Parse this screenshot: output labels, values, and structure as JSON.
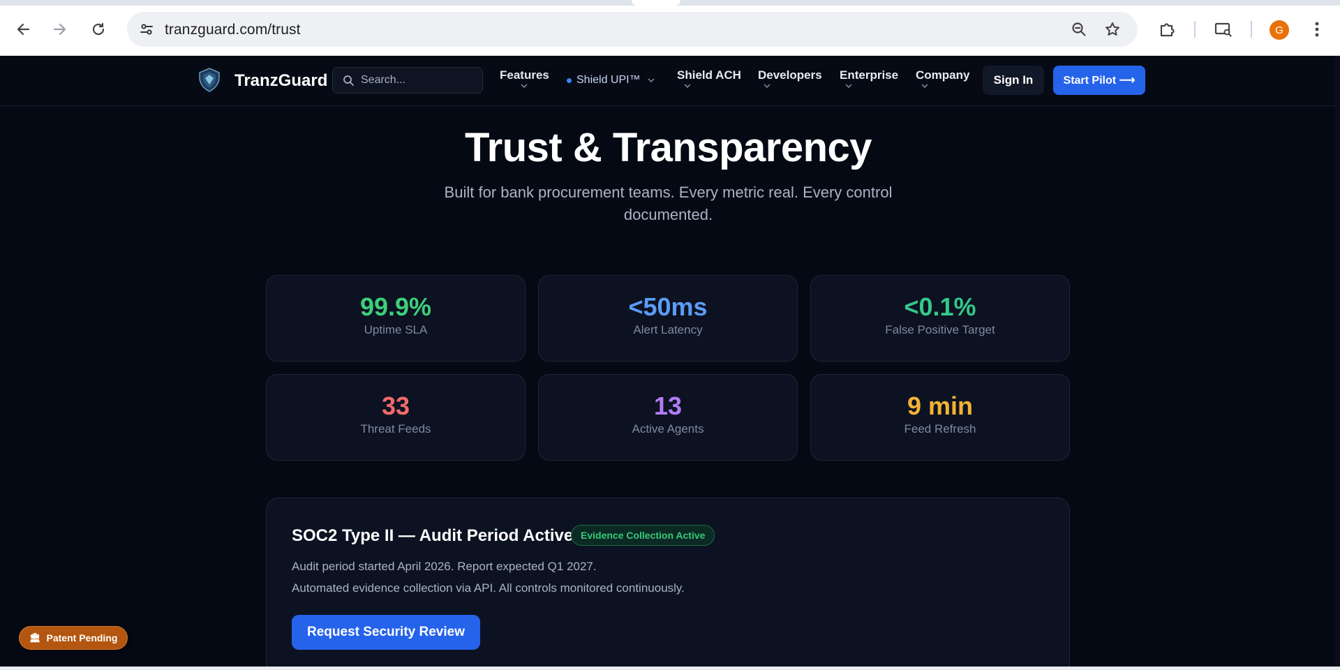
{
  "browser": {
    "url": "tranzguard.com/trust",
    "profile_initial": "G",
    "icons": {
      "back": "arrow-left-icon",
      "forward": "arrow-right-icon",
      "reload": "reload-icon",
      "site_info": "tune-icon",
      "zoom": "zoom-out-icon",
      "bookmark": "star-icon",
      "extensions": "puzzle-icon",
      "cast": "screen-search-icon",
      "menu": "kebab-menu-icon"
    }
  },
  "header": {
    "brand": "TranzGuard",
    "search_placeholder": "Search...",
    "nav": {
      "features": "Features",
      "shield_upi": "Shield UPI™",
      "shield_ach": "Shield ACH",
      "developers": "Developers",
      "enterprise": "Enterprise",
      "company": "Company"
    },
    "sign_in": "Sign In",
    "start_pilot": "Start Pilot ⟶"
  },
  "hero": {
    "title": "Trust & Transparency",
    "subtitle": "Built for bank procurement teams. Every metric real. Every control documented."
  },
  "metrics": [
    {
      "value": "99.9%",
      "label": "Uptime SLA",
      "color": "#3ecf7a"
    },
    {
      "value": "<50ms",
      "label": "Alert Latency",
      "color": "#5b9cf6"
    },
    {
      "value": "<0.1%",
      "label": "False Positive Target",
      "color": "#34c98a"
    },
    {
      "value": "33",
      "label": "Threat Feeds",
      "color": "#f26b6b"
    },
    {
      "value": "13",
      "label": "Active Agents",
      "color": "#b07cf5"
    },
    {
      "value": "9 min",
      "label": "Feed Refresh",
      "color": "#f2b233"
    }
  ],
  "soc2": {
    "title": "SOC2 Type II — Audit Period Active",
    "badge": "Evidence Collection Active",
    "line1": "Audit period started April 2026. Report expected Q1 2027.",
    "line2": "Automated evidence collection via API. All controls monitored continuously.",
    "button": "Request Security Review"
  },
  "patent_pill": "Patent Pending",
  "colors": {
    "accent": "#2563eb",
    "page_bg": "#050914",
    "card_bg": "#0c1221"
  }
}
